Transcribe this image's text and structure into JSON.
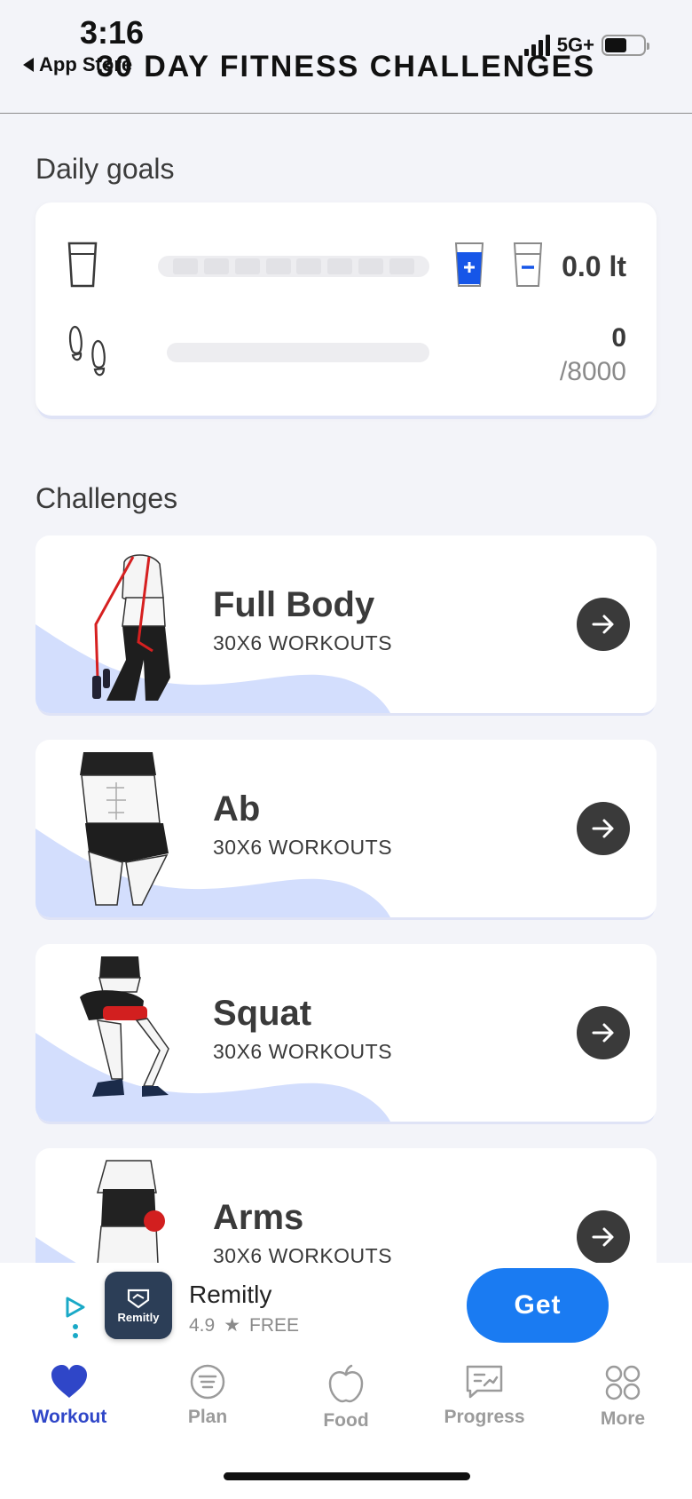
{
  "status_bar": {
    "time": "3:16",
    "back_label": "App Store",
    "network": "5G+"
  },
  "header": {
    "title": "30 DAY FITNESS CHALLENGES"
  },
  "daily_goals": {
    "title": "Daily goals",
    "water": {
      "amount": "0.0 lt",
      "filled_cups": 0,
      "total_cups": 8
    },
    "steps": {
      "count": "0",
      "target": "/8000",
      "progress": 0
    }
  },
  "challenges": {
    "title": "Challenges",
    "items": [
      {
        "name": "Full Body",
        "subtitle": "30X6 WORKOUTS"
      },
      {
        "name": "Ab",
        "subtitle": "30X6 WORKOUTS"
      },
      {
        "name": "Squat",
        "subtitle": "30X6 WORKOUTS"
      },
      {
        "name": "Arms",
        "subtitle": "30X6 WORKOUTS"
      }
    ]
  },
  "ad": {
    "app_name": "Remitly",
    "logo_text": "Remitly",
    "rating": "4.9",
    "price": "FREE",
    "cta": "Get"
  },
  "nav": {
    "items": [
      {
        "label": "Workout",
        "icon": "heart-icon",
        "active": true
      },
      {
        "label": "Plan",
        "icon": "plan-icon",
        "active": false
      },
      {
        "label": "Food",
        "icon": "apple-icon",
        "active": false
      },
      {
        "label": "Progress",
        "icon": "chart-icon",
        "active": false
      },
      {
        "label": "More",
        "icon": "grid-icon",
        "active": false
      }
    ]
  },
  "colors": {
    "accent": "#2f46c8",
    "cta_blue": "#1a7bf2",
    "wave": "#d3defd",
    "water_blue": "#1656e8"
  }
}
